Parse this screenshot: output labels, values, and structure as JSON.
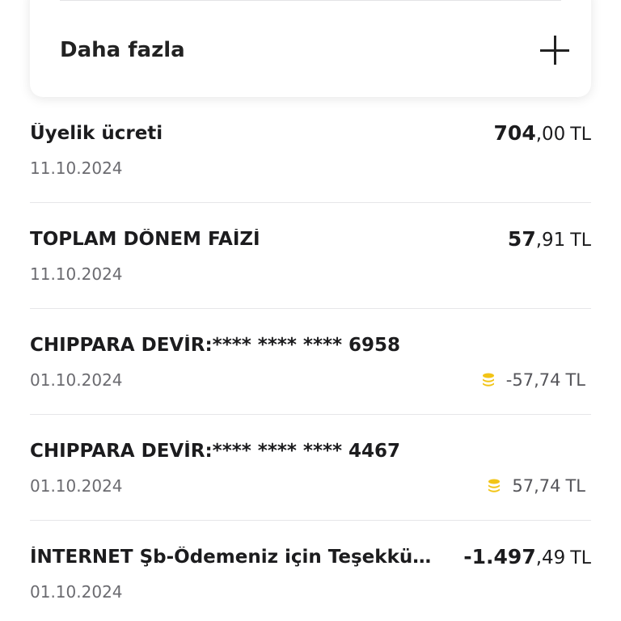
{
  "more": {
    "label": "Daha fazla"
  },
  "transactions": [
    {
      "title": "Üyelik ücreti",
      "date": "11.10.2024",
      "whole": "704",
      "frac": ",00",
      "currency": "TL"
    },
    {
      "title": "TOPLAM DÖNEM FAİZİ",
      "date": "11.10.2024",
      "whole": "57",
      "frac": ",91",
      "currency": "TL"
    },
    {
      "title": "CHIPPARA DEVİR:**** **** **** 6958",
      "date": "01.10.2024",
      "amount": "-57,74",
      "currency": "TL"
    },
    {
      "title": "CHIPPARA DEVİR:**** **** **** 4467",
      "date": "01.10.2024",
      "amount": "57,74",
      "currency": "TL"
    },
    {
      "title": "İNTERNET Şb-Ödemeniz için Teşekkür...",
      "date": "01.10.2024",
      "whole": "-1.497",
      "frac": ",49",
      "currency": "TL"
    }
  ],
  "colors": {
    "coin": "#f2c416",
    "divider": "#e6e6e9",
    "muted_text": "#6b6b70"
  }
}
